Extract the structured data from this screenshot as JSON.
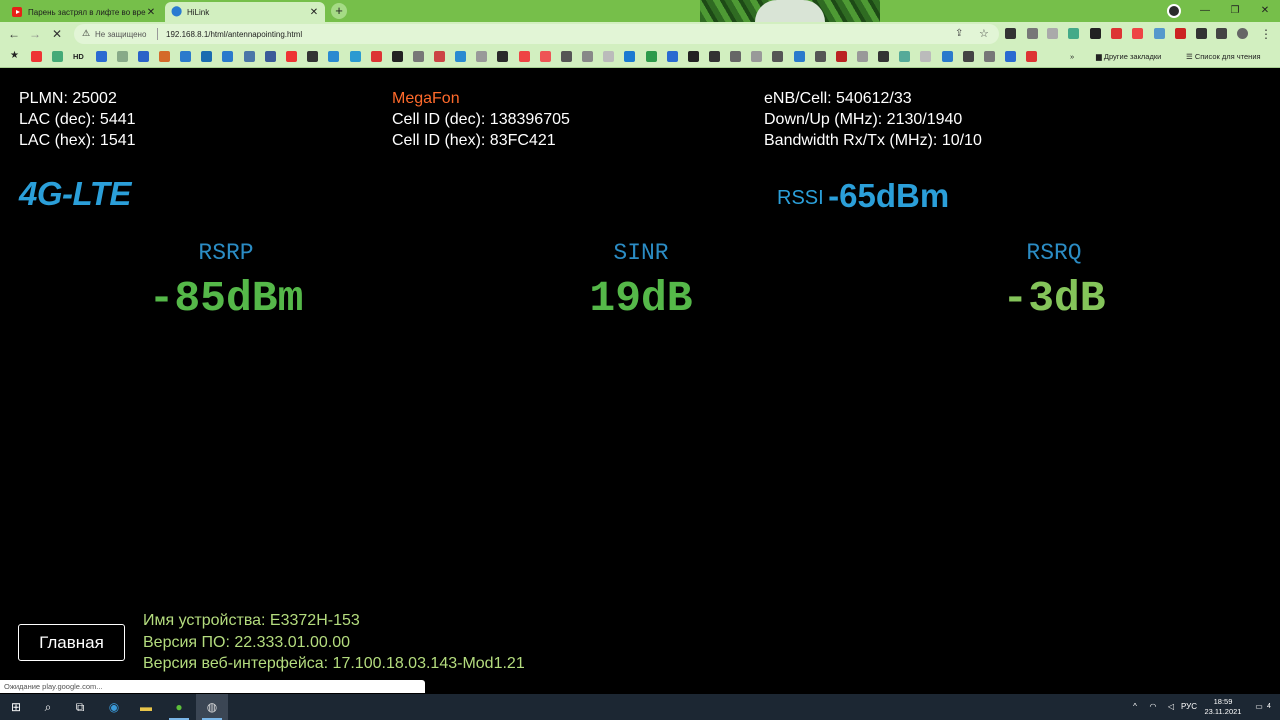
{
  "browser": {
    "tabs": [
      {
        "title": "Парень застрял в лифте во вре",
        "favicon": "youtube-icon"
      },
      {
        "title": "HiLink",
        "favicon": "location-pin-icon"
      }
    ],
    "security_label": "Не защищено",
    "url": "192.168.8.1/html/antennapointing.html",
    "other_bookmarks": "Другие закладки",
    "reading_list": "Список для чтения",
    "bookmark_hd": "HD",
    "status_text": "Ожидание play.google.com..."
  },
  "network": {
    "plmn": "PLMN: 25002",
    "lac_dec": "LAC (dec): 5441",
    "lac_hex": "LAC (hex): 1541",
    "operator": "MegaFon",
    "cell_id_dec": "Cell ID (dec): 138396705",
    "cell_id_hex": "Cell ID (hex): 83FC421",
    "enb_cell": "eNB/Cell: 540612/33",
    "down_up": "Down/Up (MHz): 2130/1940",
    "bandwidth": "Bandwidth Rx/Tx (MHz): 10/10",
    "technology": "4G-LTE",
    "rssi_label": "RSSI",
    "rssi_value": "-65dBm"
  },
  "metrics": [
    {
      "label": "RSRP",
      "value": "-85dBm"
    },
    {
      "label": "SINR",
      "value": "19dB"
    },
    {
      "label": "RSRQ",
      "value": "-3dB"
    }
  ],
  "colors": {
    "operator": "#ff6a2b",
    "accent_blue": "#2b9fd9",
    "metric_green": "#55b849",
    "device_info": "#b4dc7e",
    "browser_frame": "#d2efc0"
  },
  "footer": {
    "home_button": "Главная",
    "device_name": "Имя устройства: E3372H-153",
    "firmware": "Версия ПО: 22.333.01.00.00",
    "web_ui": "Версия веб-интерфейса: 17.100.18.03.143-Mod1.21"
  },
  "taskbar": {
    "language": "РУС",
    "time": "18:59",
    "date": "23.11.2021",
    "notification_count": "4"
  }
}
